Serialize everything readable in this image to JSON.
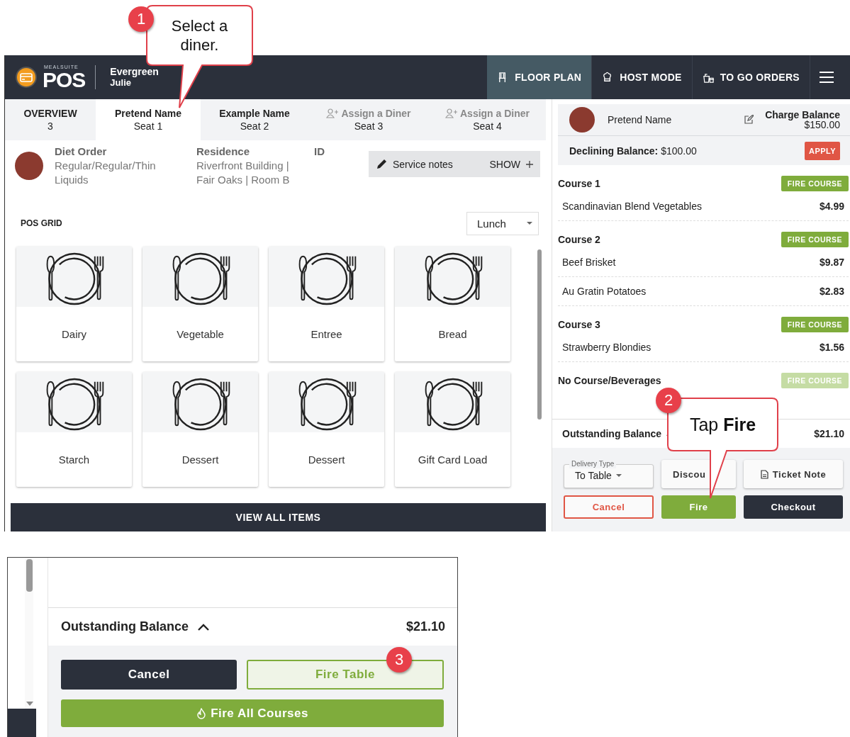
{
  "callouts": [
    {
      "number": "1",
      "text": "Select a diner."
    },
    {
      "number": "2",
      "text": "Tap **Fire**"
    }
  ],
  "header": {
    "brand_small": "MEALSUITE",
    "brand": "POS",
    "location": "Evergreen",
    "user": "Julie",
    "nav": [
      {
        "label": "FLOOR PLAN",
        "selected": true
      },
      {
        "label": "HOST MODE",
        "selected": false
      },
      {
        "label": "TO GO ORDERS",
        "selected": false
      }
    ]
  },
  "seat_tabs": [
    {
      "kind": "overview",
      "title": "OVERVIEW",
      "subtitle": "3",
      "selected": false
    },
    {
      "kind": "diner",
      "title": "Pretend Name",
      "subtitle": "Seat 1",
      "selected": true
    },
    {
      "kind": "diner",
      "title": "Example Name",
      "subtitle": "Seat 2",
      "selected": false
    },
    {
      "kind": "assign",
      "title": "Assign a Diner",
      "subtitle": "Seat 3",
      "selected": false
    },
    {
      "kind": "assign",
      "title": "Assign a Diner",
      "subtitle": "Seat 4",
      "selected": false
    }
  ],
  "diner_info": {
    "fields": [
      {
        "label": "Diet Order",
        "value": "Regular/Regular/Thin Liquids"
      },
      {
        "label": "Residence",
        "value": "Riverfront Building | Fair Oaks | Room B"
      },
      {
        "label": "ID"
      }
    ],
    "service_notes": {
      "label": "Service notes",
      "action": "SHOW"
    }
  },
  "pos_grid": {
    "title": "POS GRID",
    "meal": "Lunch",
    "items": [
      "Dairy",
      "Vegetable",
      "Entree",
      "Bread",
      "Starch",
      "Dessert",
      "Dessert",
      "Gift Card Load"
    ],
    "view_all": "VIEW ALL ITEMS"
  },
  "order": {
    "diner": "Pretend Name",
    "charge_label": "Charge Balance",
    "charge": "$150.00",
    "declining": "**Declining Balance:** $100.00",
    "apply": "APPLY",
    "courses": [
      {
        "name": "Course 1",
        "fire": "FIRE COURSE",
        "disabled": false,
        "items": [
          {
            "name": "Scandinavian Blend Vegetables",
            "price": "$4.99"
          }
        ]
      },
      {
        "name": "Course 2",
        "fire": "FIRE COURSE",
        "disabled": false,
        "items": [
          {
            "name": "Beef Brisket",
            "price": "$9.87"
          },
          {
            "name": "Au Gratin Potatoes",
            "price": "$2.83"
          }
        ]
      },
      {
        "name": "Course 3",
        "fire": "FIRE COURSE",
        "disabled": false,
        "items": [
          {
            "name": "Strawberry Blondies",
            "price": "$1.56"
          }
        ]
      },
      {
        "name": "No Course/Beverages",
        "fire": "FIRE COURSE",
        "disabled": true
      }
    ],
    "outstanding_label": "Outstanding Balance",
    "outstanding": "$21.10",
    "delivery_label": "Delivery Type",
    "delivery": "To Table",
    "buttons": [
      {
        "kind": "secondary",
        "label": "Discou"
      },
      {
        "kind": "note",
        "label": "Ticket Note"
      },
      {
        "kind": "cancel",
        "label": "Cancel"
      },
      {
        "kind": "fire",
        "label": "Fire"
      },
      {
        "kind": "dark",
        "label": "Checkout"
      }
    ]
  },
  "detail": {
    "outstanding_label": "Outstanding Balance",
    "outstanding": "$21.10",
    "badge": "3",
    "buttons": [
      {
        "kind": "dark",
        "label": "Cancel"
      },
      {
        "kind": "fire_table",
        "label": "Fire Table"
      },
      {
        "kind": "fire_all",
        "label": "Fire All Courses"
      }
    ]
  }
}
